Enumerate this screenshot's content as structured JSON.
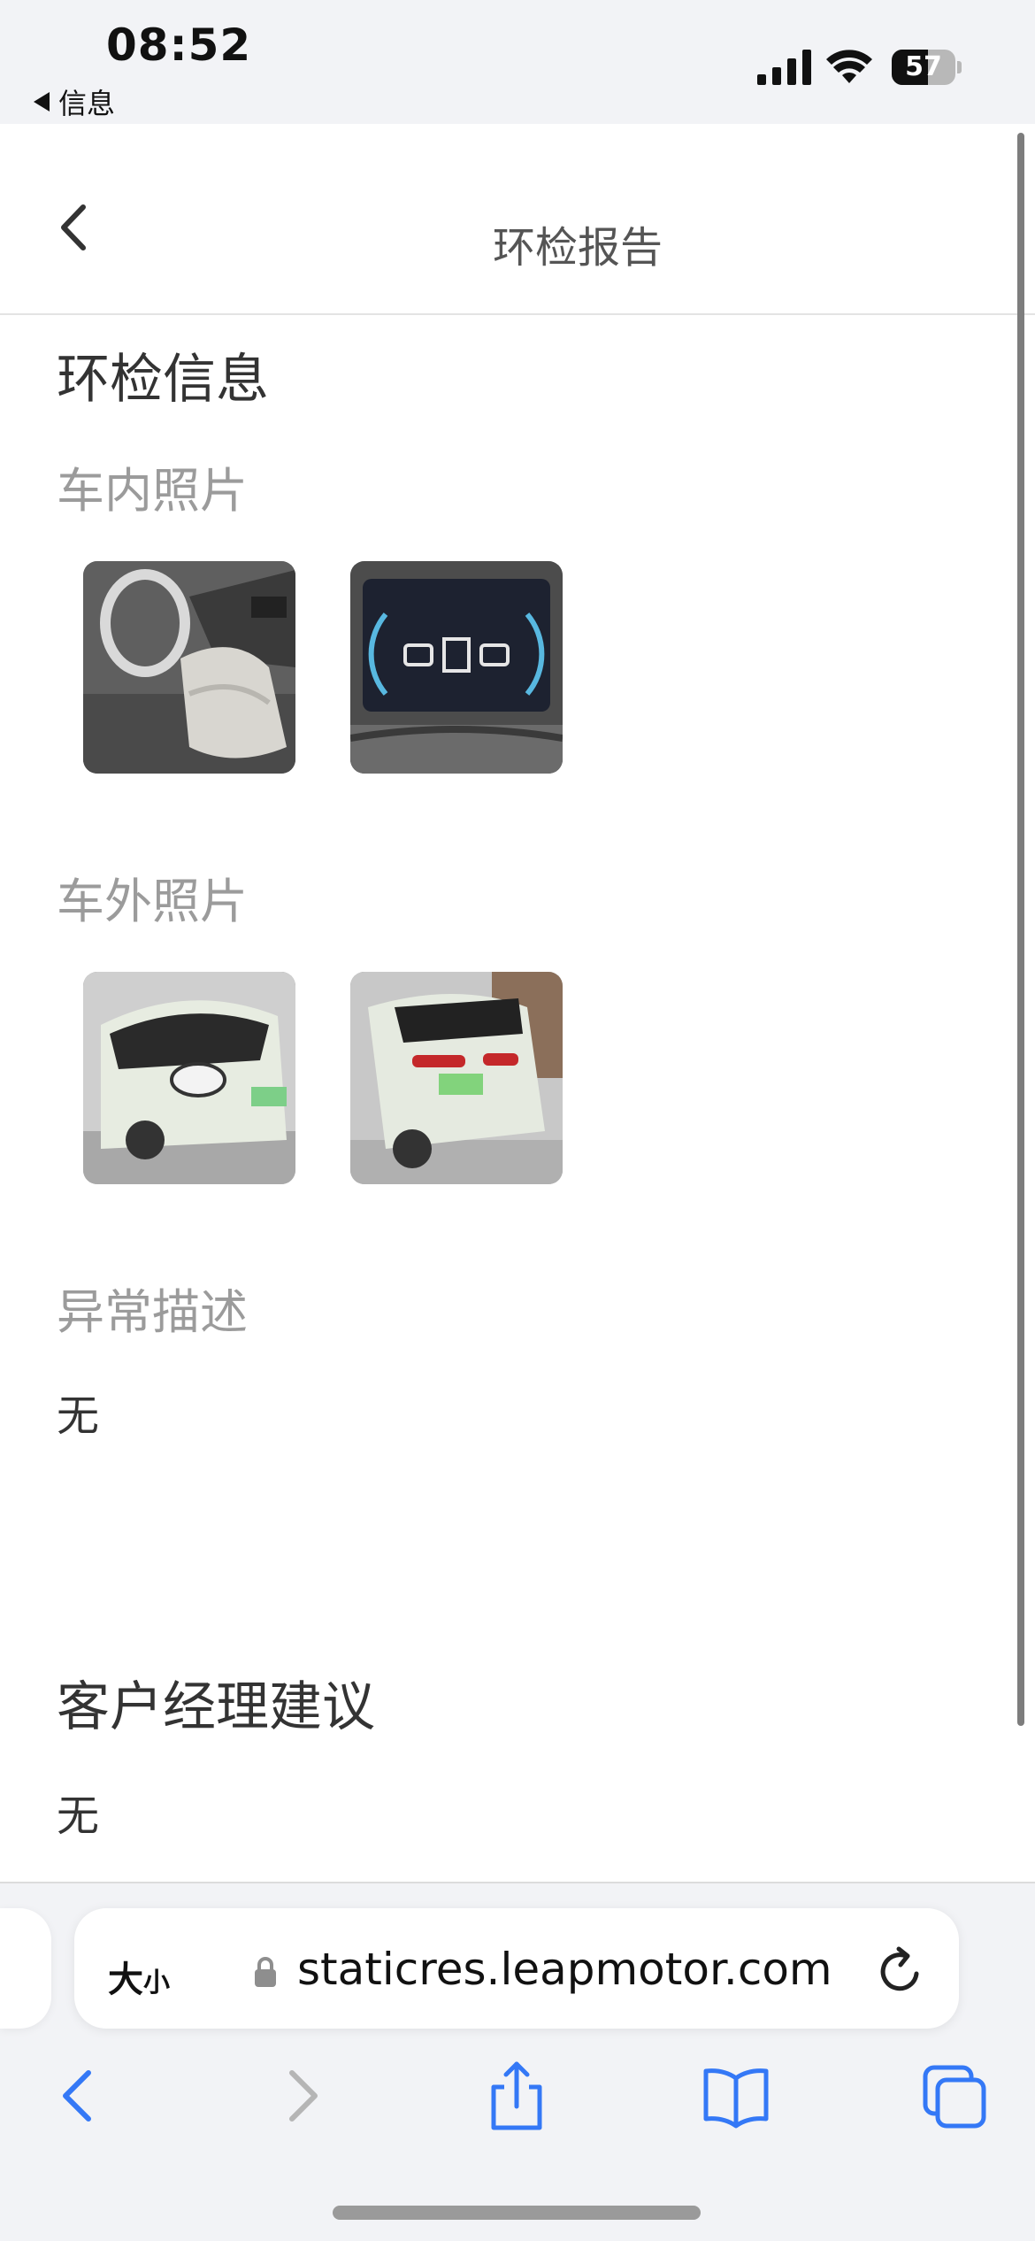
{
  "status_bar": {
    "time": "08:52",
    "back_app_label": "信息",
    "battery_level": "57",
    "battery_fraction": 0.57
  },
  "header": {
    "title": "环检报告"
  },
  "content": {
    "section_title": "环检信息",
    "interior_label": "车内照片",
    "exterior_label": "车外照片",
    "abnormal_label": "异常描述",
    "abnormal_value": "无",
    "manager_title": "客户经理建议",
    "manager_value": "无",
    "interior_photos": [
      "car-interior-seat-photo",
      "dashboard-display-photo"
    ],
    "exterior_photos": [
      "car-front-exterior-photo",
      "car-rear-exterior-photo"
    ]
  },
  "browser": {
    "text_size_label_big": "大",
    "text_size_label_small": "小",
    "url": "staticres.leapmotor.com"
  },
  "icons": {
    "back": "chevron-left-icon",
    "lock": "lock-icon",
    "reload": "reload-icon",
    "nav_back": "browser-back-icon",
    "nav_forward": "browser-forward-icon",
    "share": "share-icon",
    "bookmarks": "bookmarks-icon",
    "tabs": "tabs-icon"
  },
  "colors": {
    "accent": "#3478f6",
    "disabled": "#b5b5b5",
    "label_gray": "#9b9b9b"
  }
}
